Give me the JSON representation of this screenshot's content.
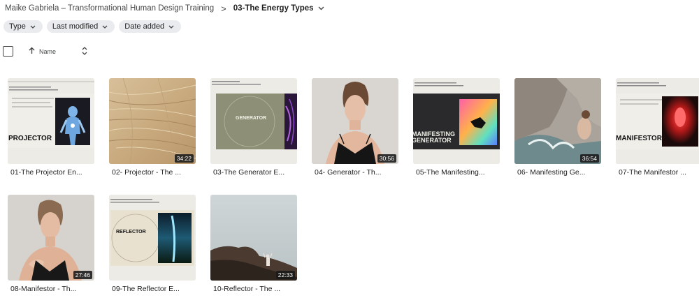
{
  "breadcrumb": {
    "parent": "Maike Gabriela – Transformational Human Design Training",
    "separator": ">",
    "current": "03-The Energy Types"
  },
  "filters": [
    {
      "label": "Type"
    },
    {
      "label": "Last modified"
    },
    {
      "label": "Date added"
    }
  ],
  "sort": {
    "label": "Name"
  },
  "icons": {
    "chevron": "chevron-down-icon",
    "sort_arrow": "arrow-up-icon",
    "sort_toggle": "unfold-icon"
  },
  "videos": [
    {
      "title": "01-The Projector En...",
      "duration": "",
      "slide_text": "PROJECTOR"
    },
    {
      "title": "02- Projector - The ...",
      "duration": "34:22"
    },
    {
      "title": "03-The Generator E...",
      "duration": "",
      "slide_text": "GENERATOR"
    },
    {
      "title": "04- Generator - Th...",
      "duration": "30:56"
    },
    {
      "title": "05-The Manifesting...",
      "duration": "",
      "slide_text": "MANIFESTING GENERATOR"
    },
    {
      "title": "06- Manifesting Ge...",
      "duration": "36:54"
    },
    {
      "title": "07-The Manifestor ...",
      "duration": "",
      "slide_text": "MANIFESTOR"
    },
    {
      "title": "08-Manifestor - Th...",
      "duration": "27:46"
    },
    {
      "title": "09-The Reflector E...",
      "duration": "",
      "slide_text": "REFLECTOR"
    },
    {
      "title": "10-Reflector - The ...",
      "duration": "22:33"
    }
  ],
  "colors": {
    "chip_bg": "#e9ebee",
    "text": "#1f1f1f",
    "secondary_text": "#444746"
  }
}
